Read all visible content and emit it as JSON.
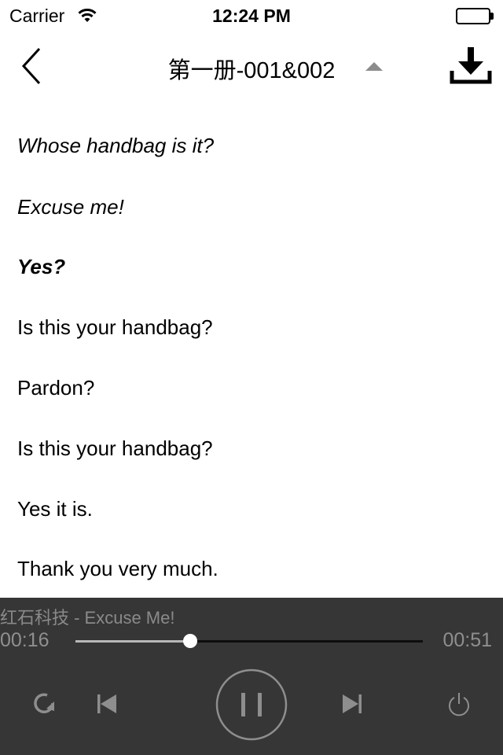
{
  "status_bar": {
    "carrier": "Carrier",
    "time": "12:24 PM"
  },
  "nav": {
    "title": "第一册-001&002",
    "back_icon": "chevron-left-icon",
    "expand_icon": "triangle-up-icon",
    "download_icon": "download-icon"
  },
  "lyrics": [
    {
      "text": "Whose handbag is it?",
      "style": "italic"
    },
    {
      "text": "Excuse me!",
      "style": "italic"
    },
    {
      "text": "Yes?",
      "style": "bold-italic",
      "current": true
    },
    {
      "text": "Is this your handbag?",
      "style": "normal"
    },
    {
      "text": "Pardon?",
      "style": "normal"
    },
    {
      "text": "Is this your handbag?",
      "style": "normal"
    },
    {
      "text": "Yes it is.",
      "style": "normal"
    },
    {
      "text": "Thank you very much.",
      "style": "normal"
    }
  ],
  "player": {
    "track_title": "红石科技 - Excuse Me!",
    "elapsed": "00:16",
    "total": "00:51",
    "progress_fraction": 0.33,
    "controls": [
      "repeat-icon",
      "previous-icon",
      "pause-icon",
      "next-icon",
      "power-icon"
    ]
  },
  "colors": {
    "player_background": "#363636",
    "player_text": "#8f8f8f",
    "progress_played": "#b8b8b8",
    "progress_remaining": "#0d0d0d"
  }
}
